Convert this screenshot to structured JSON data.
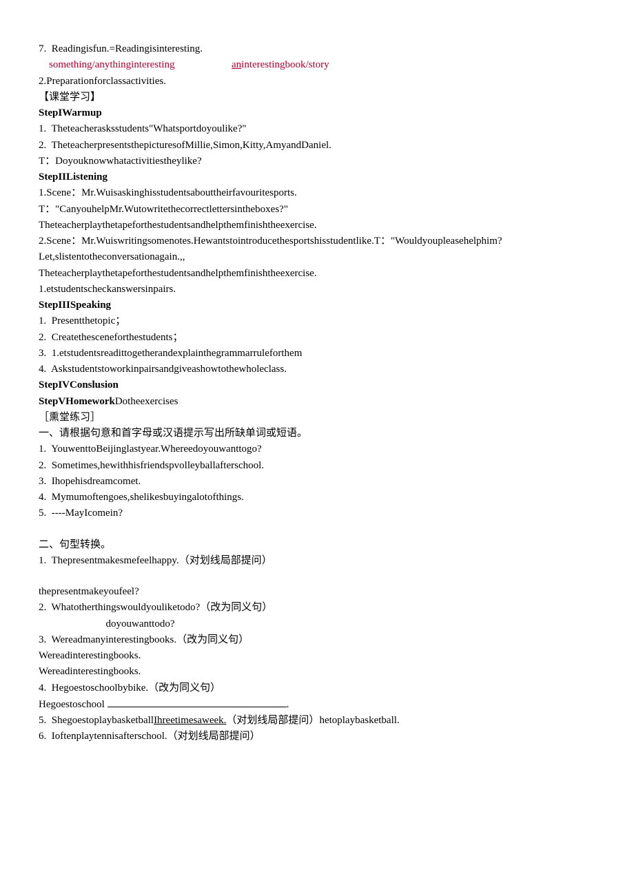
{
  "item7": {
    "num": "7.",
    "text": "Readingisfun.=Readingisinteresting.",
    "red1": "something/anythinginteresting",
    "red2a": "an",
    "red2b": "interestingbook/story"
  },
  "prep": "2.Preparationforclassactivities.",
  "ketang": "【课堂学习】",
  "step1": {
    "title": "StepIWarmup",
    "l1n": "1.",
    "l1": "Theteacherasksstudents\"Whatsportdoyoulike?\"",
    "l2n": "2.",
    "l2": "TheteacherpresentsthepicturesofMillie,Simon,Kitty,AmyandDaniel.",
    "l3": "T：Doyouknowwhatactivitiestheylike?"
  },
  "step2": {
    "title": "StepIIListening",
    "l1": "1.Scene：Mr.Wuisaskinghisstudentsabouttheirfavouritesports.",
    "l2": "T：\"CanyouhelpMr.Wutowritethecorrectlettersintheboxes?\"",
    "l3": "Theteacherplaythetapeforthestudentsandhelpthemfinishtheexercise.",
    "l4": "2.Scene：Mr.Wuiswritingsomenotes.Hewantstointroducethesportshisstudentlike.T：\"Wouldyoupleasehelphim?Let,slistentotheconversationagain.,,",
    "l5": "Theteacherplaythetapeforthestudentsandhelpthemfinishtheexercise.",
    "l6": "1.etstudentscheckanswersinpairs."
  },
  "step3": {
    "title": "StepIIISpeaking",
    "l1n": "1.",
    "l1": "Presentthetopic；",
    "l2n": "2.",
    "l2": "Createthesceneforthestudents；",
    "l3n": "3.",
    "l3": "1.etstudentsreadittogetherandexplainthegrammarruleforthem",
    "l4n": "4.",
    "l4": "Askstudentstoworkinpairsandgiveashowtothewholeclass."
  },
  "step4": {
    "title": "StepIVConslusion"
  },
  "step5": {
    "title": "StepVHomework",
    "tail": "Dotheexercises"
  },
  "suitang": "［熏堂练习］",
  "sec1": {
    "title": "一、请根据句意和首字母或汉语提示写出所缺单词或短语。",
    "q1n": "1.",
    "q1": "YouwenttoBeijinglastyear.Whereedoyouwanttogo?",
    "q2n": "2.",
    "q2": "Sometimes,hewithhisfriendspvolleyballafterschool.",
    "q3n": "3.",
    "q3": "Ihopehisdreamcomet.",
    "q4n": "4.",
    "q4": "Mymumoftengoes,shelikesbuyingalotofthings.",
    "q5n": "5.",
    "q5": "----MayIcomein?"
  },
  "sec2": {
    "title": "二、句型转换。",
    "q1n": "1.",
    "q1a": "Thepresentmakesmefeelhappy.",
    "q1b": "（对划线局部提问）",
    "q1c": "thepresentmakeyoufeel?",
    "q2n": "2.",
    "q2a": "Whatotherthingswouldyouliketodo?",
    "q2b": "（改为同义句）",
    "q2c": "doyouwanttodo?",
    "q3n": "3.",
    "q3a": "Wereadmanyinterestingbooks.",
    "q3b": "（改为同义句）",
    "q3c": "Wereadinterestingbooks.",
    "q3d": "Wereadinterestingbooks.",
    "q4n": "4.",
    "q4a": "Hegoestoschoolbybike.",
    "q4b": "（改为同义句）",
    "q4c": "Hegoestoschool",
    "q4d": ".",
    "q5n": "5.",
    "q5a": "Shegoestoplaybasketball",
    "q5u": "Ihreetimesaweek.",
    "q5b": "（对划线局部提问）",
    "q5c": "hetoplaybasketball.",
    "q6n": "6.",
    "q6a": "Ioftenplaytennisafterschool.",
    "q6b": "（对划线局部提问）"
  }
}
